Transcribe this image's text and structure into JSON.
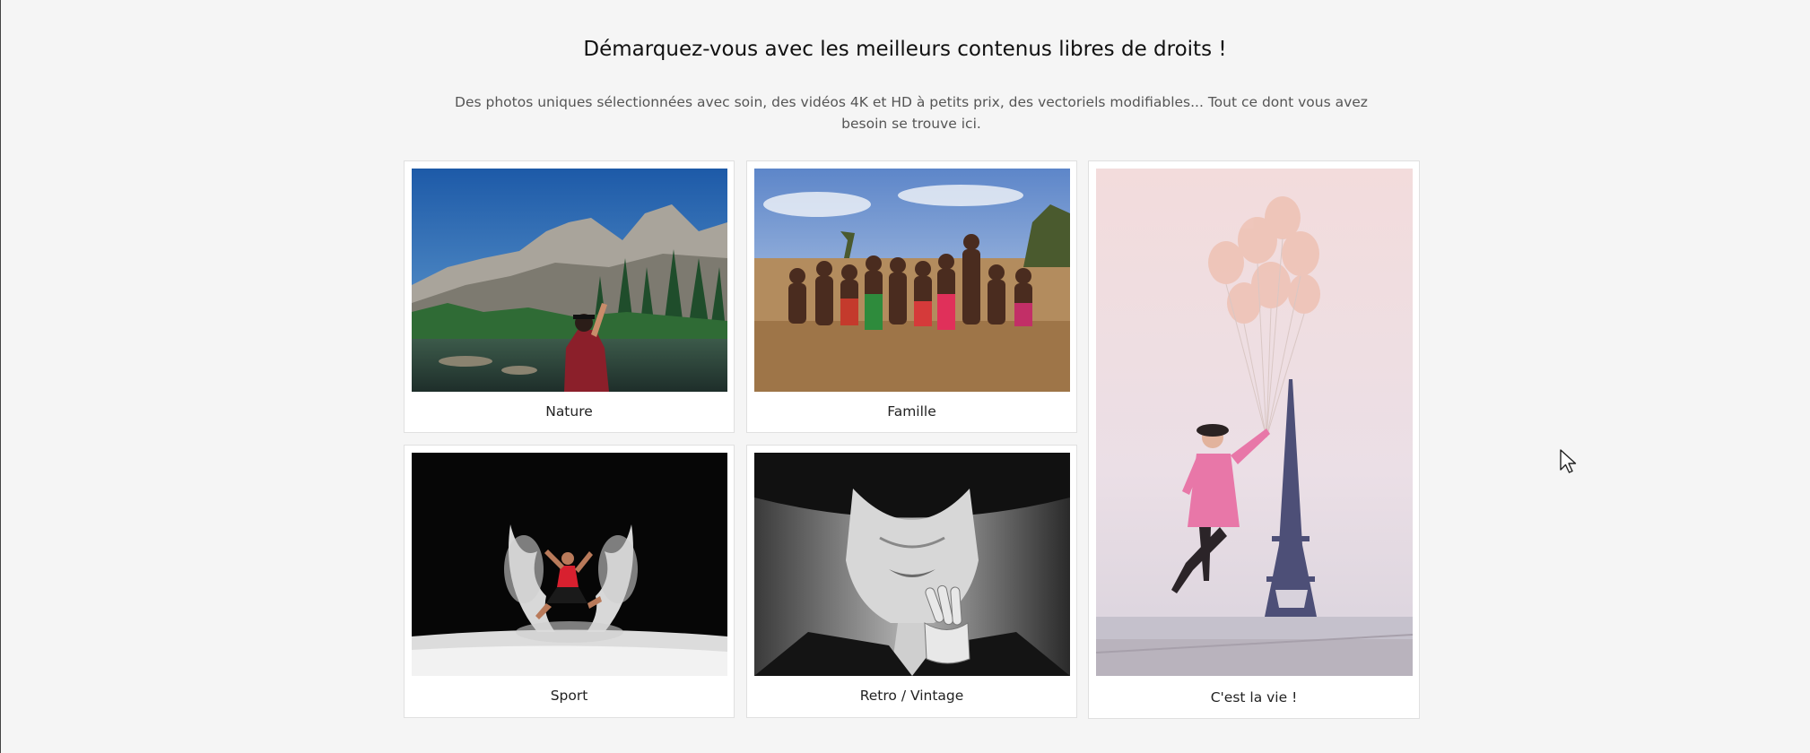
{
  "header": {
    "title": "Démarquez-vous avec les meilleurs contenus libres de droits !",
    "subtitle": "Des photos uniques sélectionnées avec soin, des vidéos 4K et HD à petits prix, des vectoriels modifiables... Tout ce dont vous avez besoin se trouve ici."
  },
  "categories": [
    {
      "label": "Nature"
    },
    {
      "label": "Famille"
    },
    {
      "label": "C'est la vie !"
    },
    {
      "label": "Sport"
    },
    {
      "label": "Retro / Vintage"
    }
  ],
  "colors": {
    "background": "#f5f5f5",
    "card": "#ffffff",
    "card_border": "#e0e0e0",
    "text": "#222222",
    "muted_text": "#555555"
  }
}
